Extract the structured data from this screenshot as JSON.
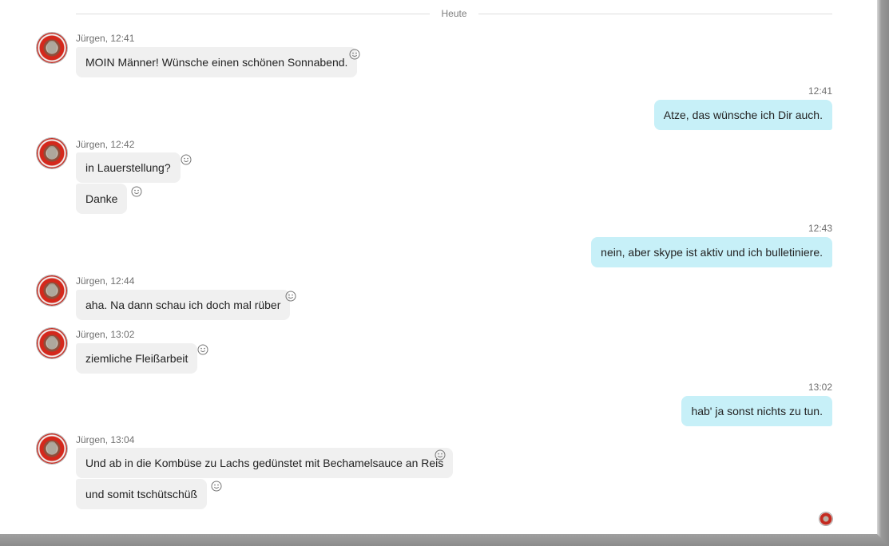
{
  "divider": {
    "label": "Heute"
  },
  "messages": [
    {
      "meta": "Jürgen, 12:41",
      "texts": [
        "MOIN Männer! Wünsche einen schönen Sonnabend."
      ]
    },
    {
      "meta": "12:41",
      "texts": [
        "Atze, das wünsche ich Dir auch."
      ]
    },
    {
      "meta": "Jürgen, 12:42",
      "texts": [
        "in Lauerstellung?",
        "Danke"
      ]
    },
    {
      "meta": "12:43",
      "texts": [
        "nein, aber skype ist aktiv und ich bulletiniere."
      ]
    },
    {
      "meta": "Jürgen, 12:44",
      "texts": [
        "aha. Na dann schau ich doch mal rüber"
      ]
    },
    {
      "meta": "Jürgen, 13:02",
      "texts": [
        "ziemliche Fleißarbeit"
      ]
    },
    {
      "meta": "13:02",
      "texts": [
        "hab' ja sonst nichts zu tun."
      ]
    },
    {
      "meta": "Jürgen, 13:04",
      "texts": [
        "Und ab in die Kombüse zu Lachs gedünstet mit Bechamelsauce an Reis",
        "und somit tschütschüß"
      ]
    }
  ],
  "icons": {
    "reaction": "smiley-icon",
    "contact_avatar": "avatar",
    "read_receipt": "read-receipt-avatar"
  },
  "colors": {
    "incoming_bubble": "#f0f0f0",
    "outgoing_bubble": "#c7f0f8",
    "meta_text": "#6f6f6f"
  }
}
